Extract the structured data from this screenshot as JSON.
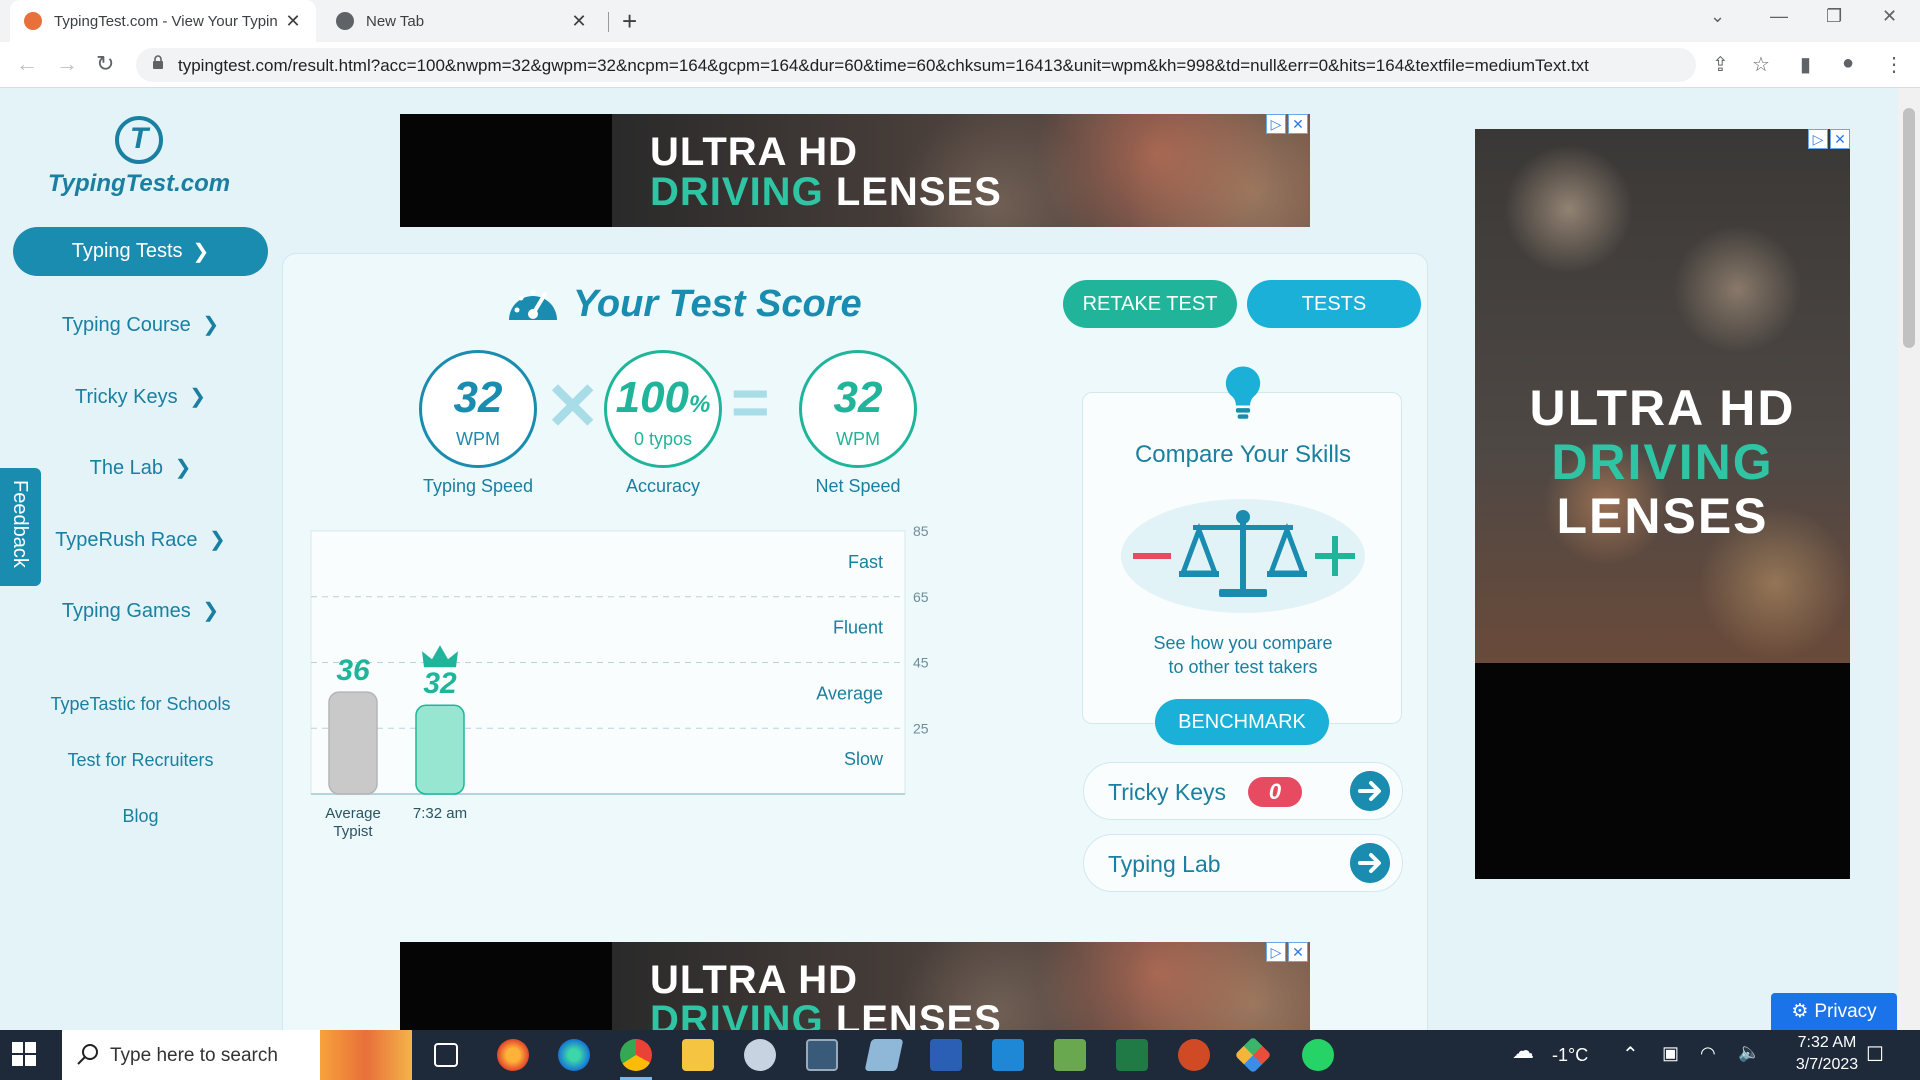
{
  "browser": {
    "tabs": [
      {
        "title": "TypingTest.com - View Your Typin",
        "active": true
      },
      {
        "title": "New Tab",
        "active": false
      }
    ],
    "url": "typingtest.com/result.html?acc=100&nwpm=32&gwpm=32&ncpm=164&gcpm=164&dur=60&time=60&chksum=16413&unit=wpm&kh=998&td=null&err=0&hits=164&textfile=mediumText.txt"
  },
  "sidebar": {
    "logo": "TypingTest.com",
    "logo_letter": "T",
    "primary": "Typing Tests",
    "items": [
      "Typing Course",
      "Tricky Keys",
      "The Lab",
      "TypeRush Race",
      "Typing Games"
    ],
    "links": [
      "TypeTastic for Schools",
      "Test for Recruiters",
      "Blog"
    ],
    "feedback": "Feedback"
  },
  "ads": {
    "line1": "ULTRA HD",
    "line2a": "DRIVING",
    "line2b": "LENSES"
  },
  "result": {
    "title": "Your Test Score",
    "retake": "RETAKE TEST",
    "tests": "TESTS",
    "speed_value": "32",
    "speed_unit": "WPM",
    "speed_caption": "Typing Speed",
    "accuracy_value": "100",
    "accuracy_pct": "%",
    "accuracy_typos": "0  typos",
    "accuracy_caption": "Accuracy",
    "net_value": "32",
    "net_unit": "WPM",
    "net_caption": "Net Speed"
  },
  "chart_data": {
    "type": "bar",
    "categories": [
      "Average Typist",
      "7:32 am"
    ],
    "values": [
      36,
      32
    ],
    "colors": [
      "#c9c9c9",
      "#96e6d2"
    ],
    "value_colors": [
      "#20b59a",
      "#20b59a"
    ],
    "ylim": [
      5,
      85
    ],
    "yticks": [
      85,
      65,
      45,
      25
    ],
    "zones": [
      "Fast",
      "Fluent",
      "Average",
      "Slow"
    ],
    "grid": true
  },
  "compare": {
    "title": "Compare Your Skills",
    "desc1": "See how you compare",
    "desc2": "to other test takers",
    "button": "BENCHMARK"
  },
  "pills": {
    "tricky_label": "Tricky Keys",
    "tricky_count": "0",
    "lab_label": "Typing Lab"
  },
  "privacy": "Privacy",
  "taskbar": {
    "search_placeholder": "Type here to search",
    "weather": "-1°C",
    "time": "7:32 AM",
    "date": "3/7/2023"
  }
}
